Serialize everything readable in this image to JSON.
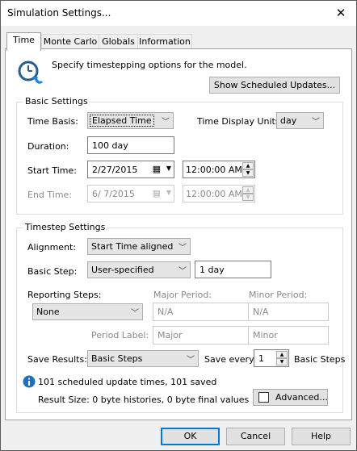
{
  "window": {
    "title": "Simulation Settings...",
    "close_glyph": "✕"
  },
  "tabs": [
    "Time",
    "Monte Carlo",
    "Globals",
    "Information"
  ],
  "header": {
    "description": "Specify timestepping options for the model.",
    "show_updates_button": "Show Scheduled Updates..."
  },
  "basic": {
    "group_label": "Basic Settings",
    "time_basis_label": "Time Basis:",
    "time_basis_value": "Elapsed Time",
    "display_units_label": "Time Display Units:",
    "display_units_value": "day",
    "duration_label": "Duration:",
    "duration_value": "100 day",
    "start_label": "Start Time:",
    "start_date": "2/27/2015",
    "start_time": "12:00:00 AM",
    "end_label": "End Time:",
    "end_date": "6/  7/2015",
    "end_time": "12:00:00 AM"
  },
  "timestep": {
    "group_label": "Timestep Settings",
    "alignment_label": "Alignment:",
    "alignment_value": "Start Time aligned",
    "basic_step_label": "Basic Step:",
    "basic_step_value": "User-specified",
    "basic_step_amount": "1 day",
    "reporting_label": "Reporting Steps:",
    "reporting_value": "None",
    "major_label": "Major Period:",
    "major_value": "N/A",
    "minor_label": "Minor Period:",
    "minor_value": "N/A",
    "period_label_label": "Period Label:",
    "period_major": "Major",
    "period_minor": "Minor",
    "save_label": "Save Results:",
    "save_value": "Basic Steps",
    "save_every_label": "Save every",
    "save_every_value": "1",
    "save_every_unit": "Basic Steps"
  },
  "info": {
    "updates": "101 scheduled update times, 101 saved",
    "result_size": "Result Size: 0 byte histories, 0 byte final values",
    "advanced_button": "Advanced..."
  },
  "footer": {
    "ok": "OK",
    "cancel": "Cancel",
    "help": "Help"
  },
  "colors": {
    "accent": "#0078d7",
    "info_icon": "#1e6fbf"
  }
}
